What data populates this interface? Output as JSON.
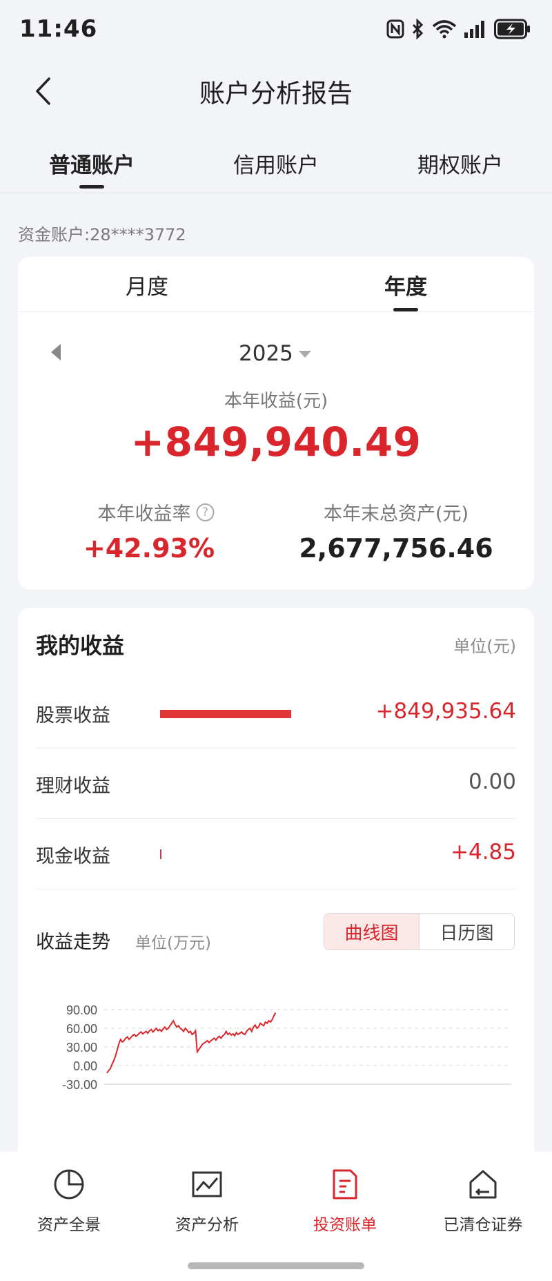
{
  "status_bar": {
    "time": "11:46"
  },
  "header": {
    "title": "账户分析报告"
  },
  "account_tabs": [
    {
      "label": "普通账户",
      "active": true
    },
    {
      "label": "信用账户",
      "active": false
    },
    {
      "label": "期权账户",
      "active": false
    }
  ],
  "fund_account": "资金账户:28****3772",
  "period_tabs": [
    {
      "label": "月度",
      "active": false
    },
    {
      "label": "年度",
      "active": true
    }
  ],
  "summary": {
    "year": "2025",
    "annual_income_label": "本年收益(元)",
    "annual_income_value": "+849,940.49",
    "return_rate_label": "本年收益率",
    "return_rate_value": "+42.93%",
    "total_assets_label": "本年末总资产(元)",
    "total_assets_value": "2,677,756.46"
  },
  "income": {
    "title": "我的收益",
    "unit": "单位(元)",
    "rows": [
      {
        "label": "股票收益",
        "value": "+849,935.64",
        "share": 1.0
      },
      {
        "label": "理财收益",
        "value": "0.00",
        "share": 0.0
      },
      {
        "label": "现金收益",
        "value": "+4.85",
        "share": 0.01
      }
    ]
  },
  "trend": {
    "title": "收益走势",
    "unit": "单位(万元)",
    "toggle": [
      {
        "label": "曲线图",
        "active": true
      },
      {
        "label": "日历图",
        "active": false
      }
    ]
  },
  "chart_data": {
    "type": "line",
    "ylim": [
      -30,
      90
    ],
    "yticks": [
      "90.00",
      "60.00",
      "30.00",
      "0.00",
      "-30.00"
    ],
    "ytick_values": [
      90,
      60,
      30,
      0,
      -30
    ],
    "grid": true,
    "x_count_total": 240,
    "values": [
      -12,
      -8,
      -5,
      2,
      8,
      15,
      25,
      35,
      42,
      38,
      40,
      44,
      46,
      42,
      45,
      48,
      50,
      47,
      49,
      52,
      54,
      51,
      53,
      55,
      52,
      56,
      58,
      54,
      57,
      60,
      56,
      58,
      55,
      59,
      62,
      58,
      60,
      64,
      68,
      72,
      66,
      62,
      64,
      60,
      58,
      55,
      60,
      57,
      53,
      55,
      50,
      52,
      56,
      22,
      26,
      30,
      34,
      36,
      38,
      40,
      37,
      40,
      42,
      44,
      41,
      45,
      47,
      44,
      48,
      50,
      55,
      50,
      52,
      49,
      51,
      48,
      53,
      50,
      52,
      54,
      51,
      50,
      55,
      58,
      60,
      55,
      62,
      65,
      60,
      62,
      68,
      66,
      64,
      70,
      68,
      72,
      70,
      74,
      80,
      85
    ]
  },
  "bottom_nav": [
    {
      "label": "资产全景",
      "icon": "pie-chart-icon",
      "active": false
    },
    {
      "label": "资产分析",
      "icon": "line-chart-icon",
      "active": false
    },
    {
      "label": "投资账单",
      "icon": "bill-icon",
      "active": true
    },
    {
      "label": "已清仓证券",
      "icon": "cleared-house-icon",
      "active": false
    }
  ],
  "colors": {
    "accent_red": "#d9262c",
    "bar_red": "#e23636",
    "background": "#f3f4f8"
  }
}
